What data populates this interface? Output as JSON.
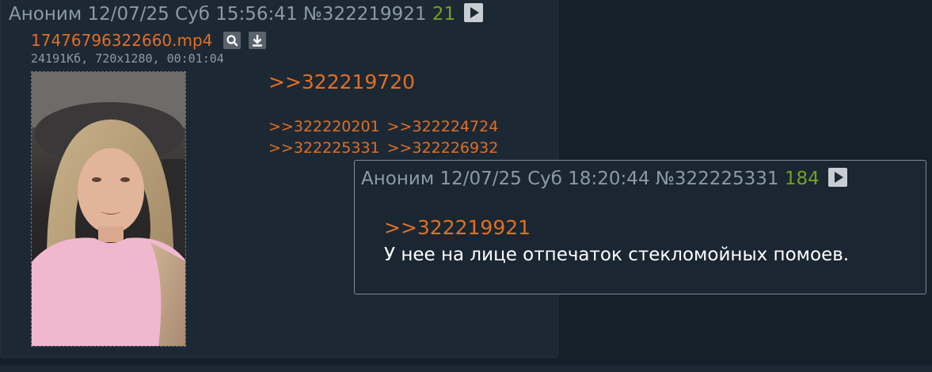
{
  "post": {
    "author": "Аноним",
    "date": "12/07/25 Суб 15:56:41",
    "number": "№322219921",
    "replies": "21",
    "file": {
      "name": "17476796322660.mp4",
      "meta": "24191Кб, 720x1280, 00:01:04",
      "search_icon": "search-icon",
      "download_icon": "download-icon"
    },
    "reply_to": ">>322219720",
    "refs": [
      [
        ">>322220201",
        ">>322224724"
      ],
      [
        ">>322225331",
        ">>322226932"
      ]
    ]
  },
  "popup": {
    "author": "Аноним",
    "date": "12/07/25 Суб 18:20:44",
    "number": "№322225331",
    "replies": "184",
    "reply_to": ">>322219921",
    "text": "У нее на лице отпечаток стекломойных помоев."
  },
  "colors": {
    "background": "#15202b",
    "post_bg": "#1d2835",
    "link": "#e16f23",
    "reply_count": "#71a31b",
    "meta": "#8b9aa6",
    "text": "#ffffff"
  }
}
